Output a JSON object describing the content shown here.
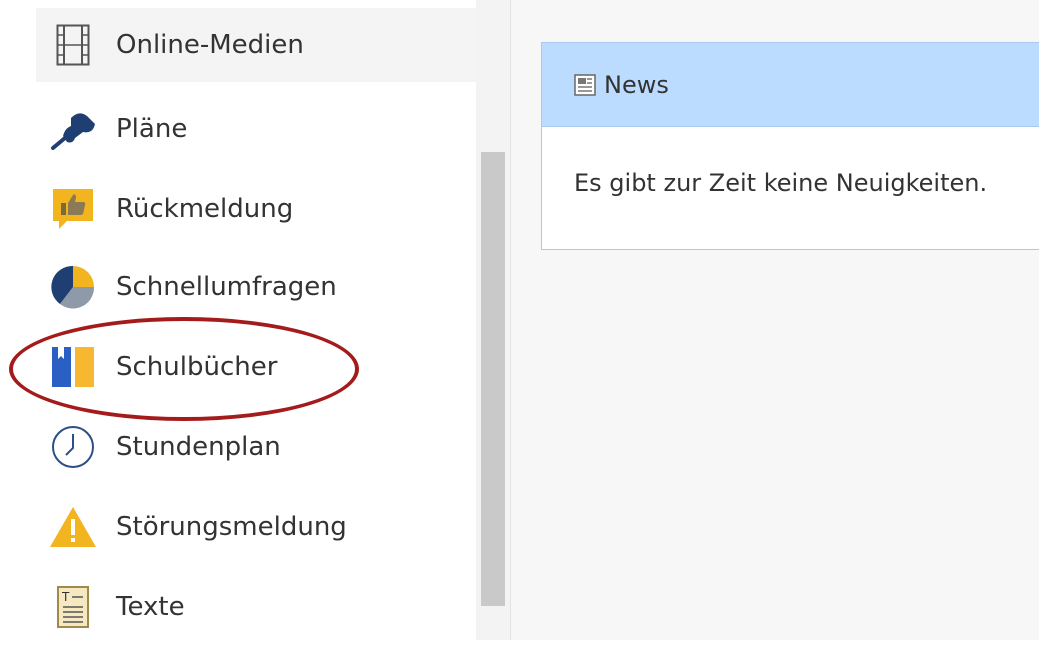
{
  "sidebar": {
    "items": [
      {
        "label": "Online-Medien",
        "icon": "film-icon"
      },
      {
        "label": "Pläne",
        "icon": "pushpin-icon"
      },
      {
        "label": "Rückmeldung",
        "icon": "thumbs-up-icon"
      },
      {
        "label": "Schnellumfragen",
        "icon": "pie-chart-icon"
      },
      {
        "label": "Schulbücher",
        "icon": "book-icon"
      },
      {
        "label": "Stundenplan",
        "icon": "clock-icon"
      },
      {
        "label": "Störungsmeldung",
        "icon": "warning-icon"
      },
      {
        "label": "Texte",
        "icon": "text-document-icon"
      }
    ],
    "active_item": "Online-Medien",
    "highlighted_item": "Schulbücher"
  },
  "news": {
    "title": "News",
    "icon": "newspaper-icon",
    "message": "Es gibt zur Zeit keine Neuigkeiten."
  },
  "colors": {
    "panel_header": "#bcdcff",
    "panel_border": "#a9c9ef",
    "highlight_ring": "#a41b1b",
    "icon_blue": "#1f4f8f",
    "icon_yellow": "#f2b51f"
  }
}
